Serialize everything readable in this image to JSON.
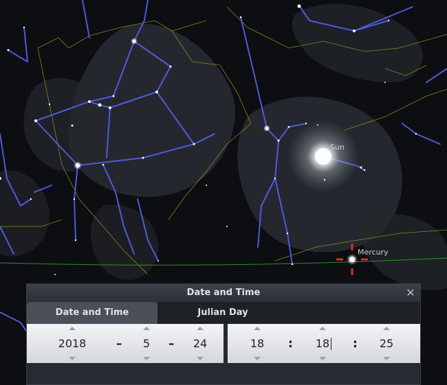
{
  "sky": {
    "labels": {
      "sun": "Sun",
      "mercury": "Mercury"
    }
  },
  "dialog": {
    "title": "Date and Time",
    "close_icon": "close-icon",
    "tabs": [
      {
        "label": "Date and Time",
        "active": true
      },
      {
        "label": "Julian Day",
        "active": false
      }
    ],
    "date": {
      "year": "2018",
      "month": "5",
      "day": "24",
      "separator": "–"
    },
    "time": {
      "hour": "18",
      "minute": "18",
      "second": "25",
      "separator": ":"
    }
  },
  "colors": {
    "constellation_lines": "#4f5adc",
    "boundaries": "#a8a21c",
    "horizon": "#2f8f2f",
    "target_marker": "#e02a2a",
    "dialog_background": "#262a31"
  }
}
